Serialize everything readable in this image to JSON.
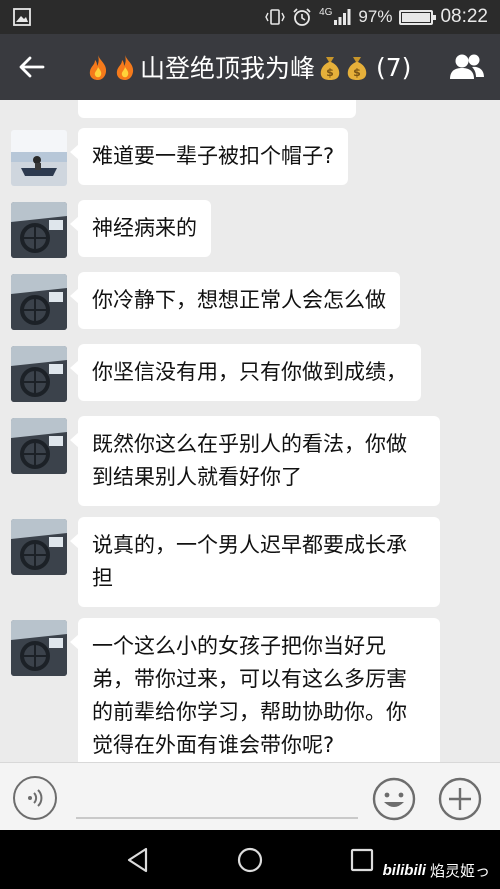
{
  "status_bar": {
    "battery_percent": "97%",
    "battery_level": 0.97,
    "network": "4G",
    "time": "08:22"
  },
  "header": {
    "title": "山登绝顶我为峰",
    "title_prefix_icons": [
      "fire-icon",
      "fire-icon"
    ],
    "title_suffix_icons": [
      "money-bag-icon",
      "money-bag-icon"
    ],
    "member_count": "(7)"
  },
  "messages": [
    {
      "sender_avatar": "avatar-sea-photo",
      "text": "难道要一辈子被扣个帽子?"
    },
    {
      "sender_avatar": "avatar-car-photo",
      "text": "神经病来的"
    },
    {
      "sender_avatar": "avatar-car-photo",
      "text": "你冷静下，想想正常人会怎么做"
    },
    {
      "sender_avatar": "avatar-car-photo",
      "text": "你坚信没有用，只有你做到成绩，"
    },
    {
      "sender_avatar": "avatar-car-photo",
      "text": "既然你这么在乎别人的看法，你做到结果别人就看好你了"
    },
    {
      "sender_avatar": "avatar-car-photo",
      "text": "说真的，一个男人迟早都要成长承担"
    },
    {
      "sender_avatar": "avatar-car-photo",
      "text": "一个这么小的女孩子把你当好兄弟，带你过来，可以有这么多厉害的前辈给你学习，帮助协助你。你觉得在外面有谁会带你呢?"
    }
  ],
  "input": {
    "value": "",
    "placeholder": ""
  },
  "watermark": {
    "logo": "bilibili",
    "text": "焰灵姬っ"
  },
  "colors": {
    "title_bar": "#393a3f",
    "status_bar": "#2b2b2b",
    "chat_background": "#ebebeb",
    "bubble": "#ffffff"
  }
}
